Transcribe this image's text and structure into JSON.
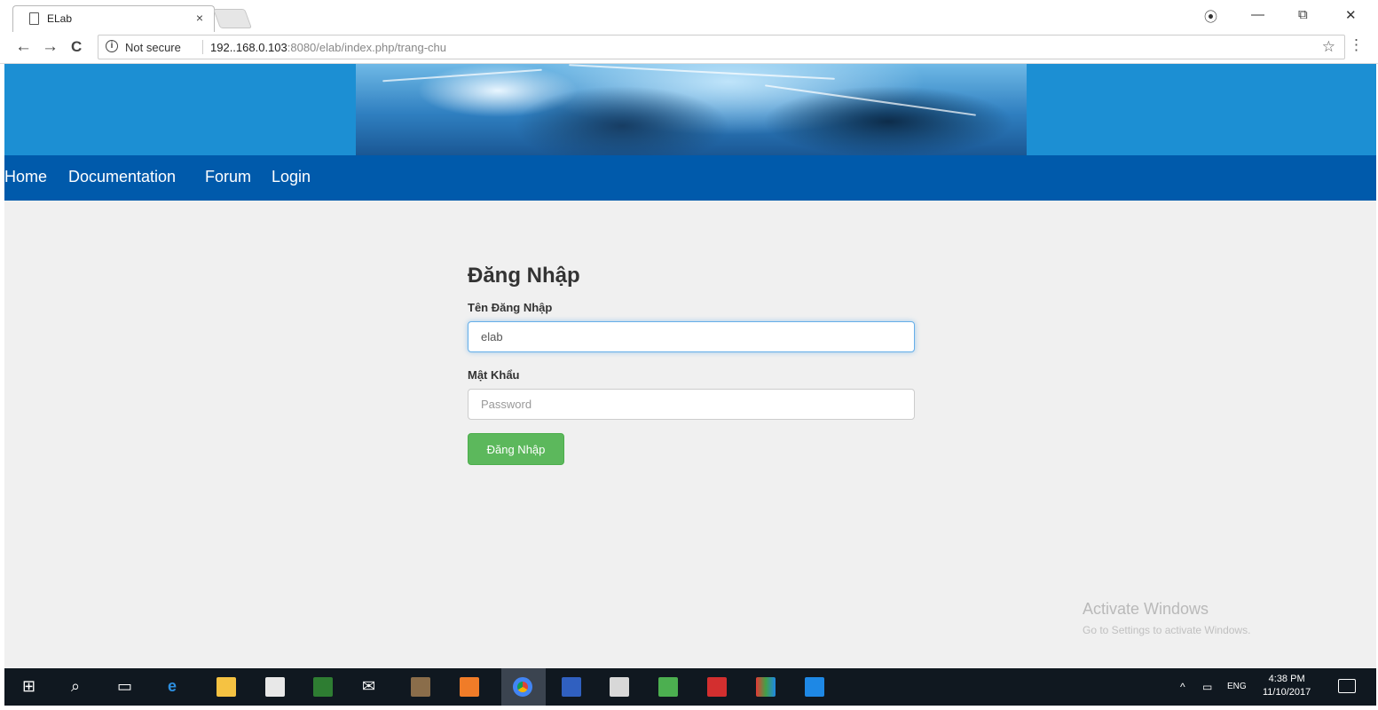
{
  "browser": {
    "tab_title": "ELab",
    "tab_close": "×",
    "window_controls": {
      "account": "⦿",
      "minimize": "—",
      "restore": "⧉",
      "close": "✕"
    },
    "nav": {
      "back": "←",
      "forward": "→",
      "reload": "C"
    },
    "omnibox": {
      "security_text": "Not secure",
      "url_host": "192..168.0.103",
      "url_rest": ":8080/elab/index.php/trang-chu"
    }
  },
  "site": {
    "nav_links": [
      "Home",
      "Documentation",
      "Forum",
      "Login"
    ]
  },
  "login": {
    "title": "Đăng Nhập",
    "username_label": "Tên Đăng Nhập",
    "username_value": "elab",
    "password_label": "Mật Khẩu",
    "password_placeholder": "Password",
    "submit_label": "Đăng Nhập"
  },
  "watermark": {
    "title": "Activate Windows",
    "subtitle": "Go to Settings to activate Windows."
  },
  "taskbar": {
    "icons": [
      "windows-start-icon",
      "search-icon",
      "task-view-icon",
      "edge-icon",
      "file-explorer-icon",
      "store-icon",
      "excel-icon",
      "mail-icon",
      "media-icon",
      "app-orange-icon",
      "chrome-icon",
      "word-icon",
      "calculator-icon",
      "app-green-icon",
      "acrobat-icon",
      "app-rgb-icon",
      "remote-desktop-icon"
    ],
    "tray_language": "ENG",
    "time": "4:38 PM",
    "date": "11/10/2017"
  },
  "colors": {
    "banner": "#1c8fd3",
    "navbar": "#005aab",
    "submit": "#5cb85c",
    "page_bg": "#f0f0f0",
    "taskbar": "#101820"
  }
}
